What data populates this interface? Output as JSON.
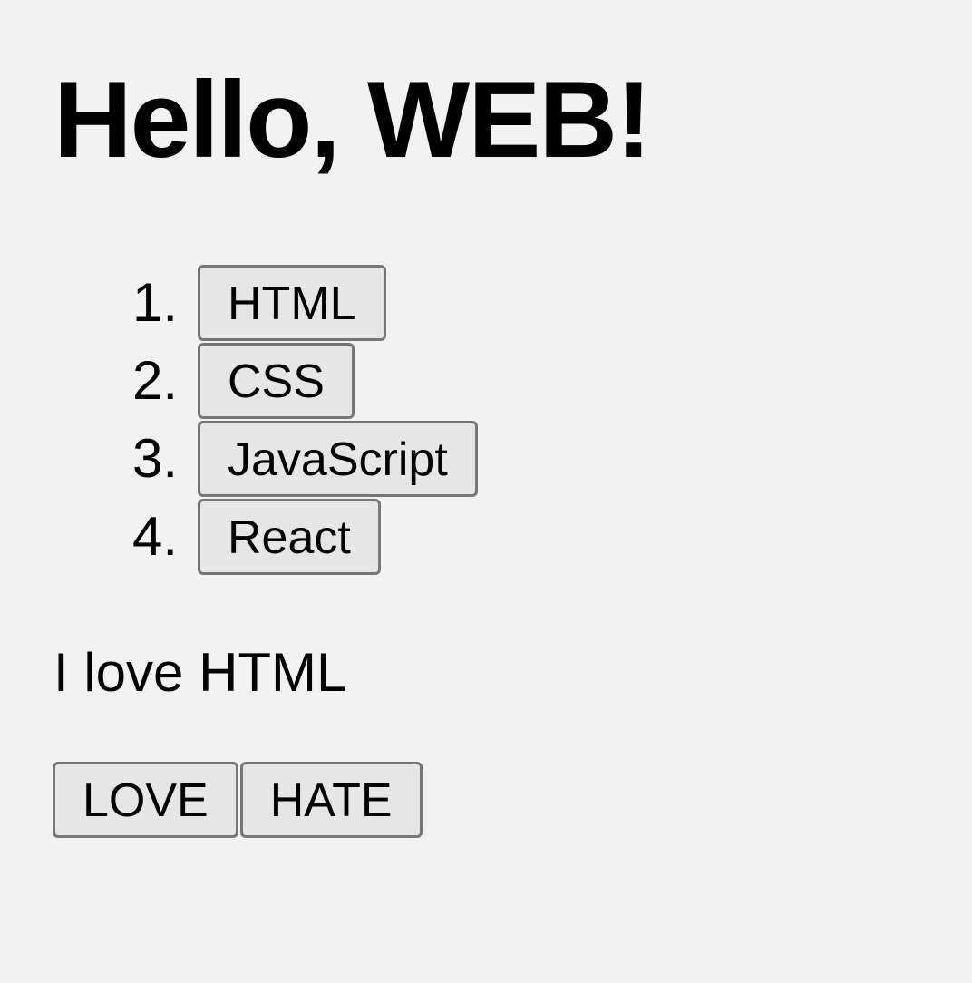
{
  "page": {
    "title": "Hello, WEB!",
    "message": "I love HTML"
  },
  "topics": [
    {
      "number": "1.",
      "label": "HTML"
    },
    {
      "number": "2.",
      "label": "CSS"
    },
    {
      "number": "3.",
      "label": "JavaScript"
    },
    {
      "number": "4.",
      "label": "React"
    }
  ],
  "actions": {
    "love_label": "LOVE",
    "hate_label": "HATE"
  }
}
